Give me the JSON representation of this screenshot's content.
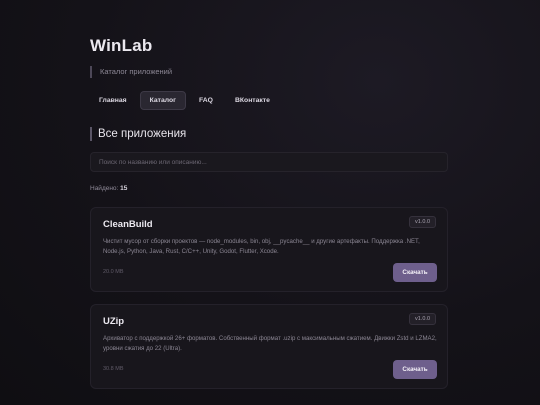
{
  "brand": "WinLab",
  "tagline": "Каталог приложений",
  "nav": [
    {
      "label": "Главная"
    },
    {
      "label": "Каталог"
    },
    {
      "label": "FAQ"
    },
    {
      "label": "ВКонтакте"
    }
  ],
  "section_title": "Все приложения",
  "search": {
    "placeholder": "Поиск по названию или описанию..."
  },
  "found": {
    "label": "Найдено:",
    "count": "15"
  },
  "apps": [
    {
      "name": "CleanBuild",
      "version": "v1.0.0",
      "description": "Чистит мусор от сборки проектов — node_modules, bin, obj, __pycache__ и другие артефакты. Поддержка .NET, Node.js, Python, Java, Rust, C/C++, Unity, Godot, Flutter, Xcode.",
      "size": "20.0 MB",
      "button": "Скачать"
    },
    {
      "name": "UZip",
      "version": "v1.0.0",
      "description": "Архиватор с поддержкой 26+ форматов. Собственный формат .uzip с максимальным сжатием. Движки Zstd и LZMA2, уровни сжатия до 22 (Ultra).",
      "size": "30.8 MB",
      "button": "Скачать"
    }
  ],
  "colors": {
    "accent_button": "#6e5f8c",
    "background": "#141218"
  }
}
